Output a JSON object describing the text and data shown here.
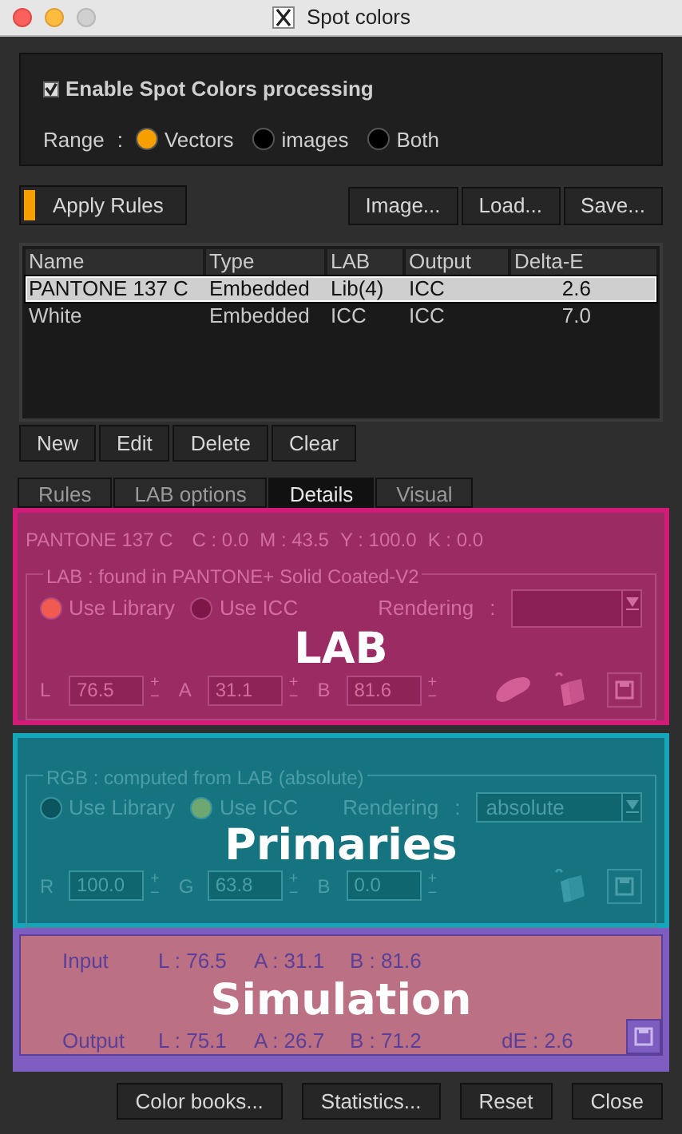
{
  "window": {
    "title": "Spot colors"
  },
  "enable": {
    "label": "Enable Spot Colors processing",
    "checked": true
  },
  "range": {
    "label": "Range",
    "separator": ":",
    "options": [
      {
        "label": "Vectors",
        "selected": true
      },
      {
        "label": "images",
        "selected": false
      },
      {
        "label": "Both",
        "selected": false
      }
    ]
  },
  "apply_rules": {
    "label": "Apply Rules",
    "indicator_on": true
  },
  "file_buttons": [
    "Image...",
    "Load...",
    "Save..."
  ],
  "table": {
    "columns": [
      "Name",
      "Type",
      "LAB",
      "Output",
      "Delta-E"
    ],
    "rows": [
      {
        "cells": [
          "PANTONE 137 C",
          "Embedded",
          "Lib(4)",
          "ICC",
          "2.6"
        ],
        "selected": true
      },
      {
        "cells": [
          "White",
          "Embedded",
          "ICC",
          "ICC",
          "7.0"
        ],
        "selected": false
      }
    ]
  },
  "list_buttons": [
    "New",
    "Edit",
    "Delete",
    "Clear"
  ],
  "tabs": [
    {
      "label": "Rules",
      "selected": false
    },
    {
      "label": "LAB options",
      "selected": false
    },
    {
      "label": "Details",
      "selected": true
    },
    {
      "label": "Visual",
      "selected": false
    }
  ],
  "lab": {
    "overlay_label": "LAB",
    "spot_name": "PANTONE 137 C",
    "cmyk": [
      "C : 0.0",
      "M : 43.5",
      "Y : 100.0",
      "K : 0.0"
    ],
    "group_title": "LAB : found in PANTONE+ Solid Coated-V2",
    "options": [
      {
        "label": "Use Library",
        "selected": true
      },
      {
        "label": "Use ICC",
        "selected": false
      }
    ],
    "rendering_label": "Rendering",
    "rendering_separator": ":",
    "fields": [
      {
        "label": "L",
        "value": "76.5"
      },
      {
        "label": "A",
        "value": "31.1"
      },
      {
        "label": "B",
        "value": "81.6"
      }
    ],
    "spin_up": "+",
    "spin_down": "−"
  },
  "primaries": {
    "overlay_label": "Primaries",
    "group_title": "RGB : computed from LAB (absolute)",
    "options": [
      {
        "label": "Use Library",
        "selected": false
      },
      {
        "label": "Use ICC",
        "selected": true
      }
    ],
    "rendering_label": "Rendering",
    "rendering_separator": ":",
    "rendering_value": "absolute",
    "fields": [
      {
        "label": "R",
        "value": "100.0"
      },
      {
        "label": "G",
        "value": "63.8"
      },
      {
        "label": "B",
        "value": "0.0"
      }
    ],
    "spin_up": "+",
    "spin_down": "−"
  },
  "simulation": {
    "overlay_label": "Simulation",
    "rows": [
      {
        "label": "Input",
        "values": [
          "L : 76.5",
          "A : 31.1",
          "B : 81.6"
        ]
      },
      {
        "label": "Output",
        "values": [
          "L : 75.1",
          "A : 26.7",
          "B : 71.2"
        ],
        "delta": "dE : 2.6"
      }
    ]
  },
  "footer_buttons": [
    "Color books...",
    "Statistics...",
    "Reset",
    "Close"
  ]
}
